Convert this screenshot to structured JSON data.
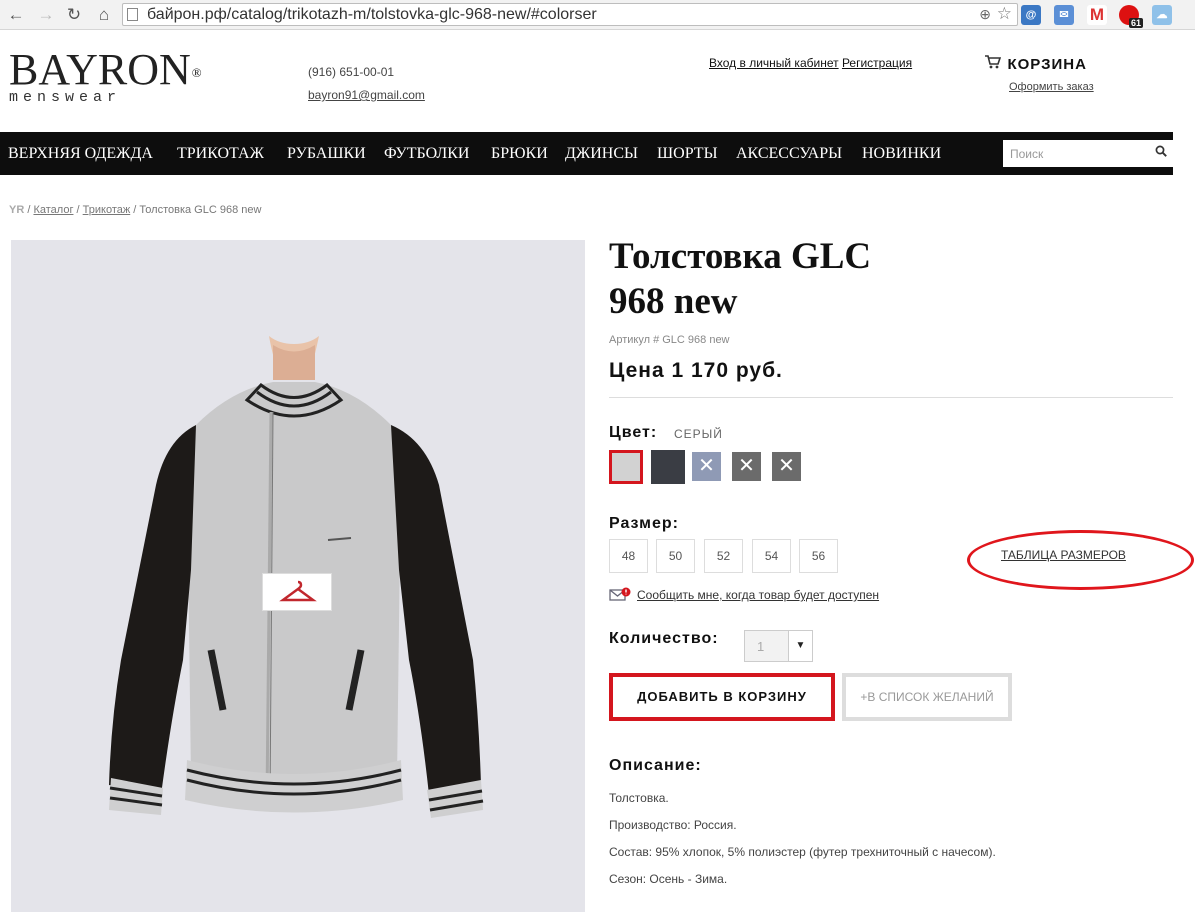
{
  "browser": {
    "url": "байрон.рф/catalog/trikotazh-m/tolstovka-glc-968-new/#colorser",
    "extension_badge": "61"
  },
  "header": {
    "logo_brand": "BAYRON",
    "logo_reg": "®",
    "logo_sub": "menswear",
    "phone": "(916) 651-00-01",
    "email": "bayron91@gmail.com",
    "login": "Вход в личный кабинет",
    "register": "Регистрация",
    "cart_label": "КОРЗИНА",
    "checkout": "Оформить заказ"
  },
  "nav": {
    "items": [
      "ВЕРХНЯЯ ОДЕЖДА",
      "ТРИКОТАЖ",
      "РУБАШКИ",
      "ФУТБОЛКИ",
      "БРЮКИ",
      "ДЖИНСЫ",
      "ШОРТЫ",
      "АКСЕССУАРЫ",
      "НОВИНКИ"
    ],
    "search_placeholder": "Поиск"
  },
  "breadcrumb": {
    "home": "YR",
    "sep": "/",
    "catalog": "Каталог",
    "category": "Трикотаж",
    "current": "Толстовка GLC 968 new"
  },
  "product": {
    "title_line1": "Толстовка GLC",
    "title_line2": "968 new",
    "sku": "Артикул # GLC 968 new",
    "price": "Цена 1 170 руб.",
    "color_label": "Цвет:",
    "color_value": "СЕРЫЙ",
    "swatches": [
      {
        "color": "#d2d2d2",
        "available": true,
        "selected": true
      },
      {
        "color": "#3a3d44",
        "available": true,
        "selected": false
      },
      {
        "color": "#8f9ab5",
        "available": false,
        "selected": false
      },
      {
        "color": "#6b6b6b",
        "available": false,
        "selected": false
      },
      {
        "color": "#6b6b6b",
        "available": false,
        "selected": false
      }
    ],
    "size_label": "Размер:",
    "sizes": [
      "48",
      "50",
      "52",
      "54",
      "56"
    ],
    "size_table": "ТАБЛИЦА РАЗМЕРОВ",
    "notify": "Сообщить мне, когда товар будет доступен",
    "qty_label": "Количество:",
    "qty_value": "1",
    "add_to_cart": "ДОБАВИТЬ В КОРЗИНУ",
    "wishlist": "+В СПИСОК ЖЕЛАНИЙ",
    "desc_title": "Описание:",
    "description": [
      "Толстовка.",
      "Производство: Россия.",
      "Состав: 95% хлопок, 5% полиэстер (футер трехниточный с начесом).",
      "Сезон: Осень - Зима."
    ]
  },
  "colors": {
    "nav_bg": "#0d0d0d",
    "accent_red": "#d4161e"
  }
}
